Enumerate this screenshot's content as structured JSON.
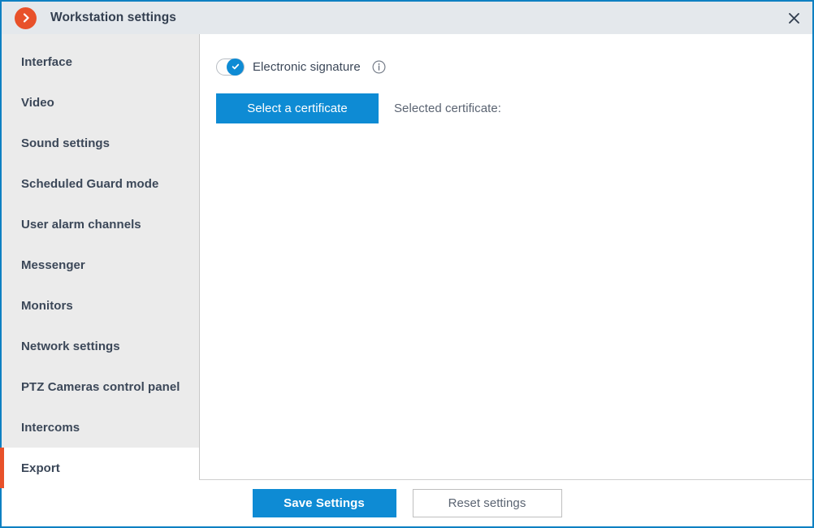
{
  "window": {
    "title": "Workstation settings",
    "app_icon": "chevron-right-circle-icon",
    "close_icon": "close-icon",
    "accent_orange": "#e8512a",
    "accent_blue": "#0e8bd4",
    "border_color": "#0e80c2",
    "titlebar_bg": "#e4e8ec",
    "sidebar_bg": "#ebebeb"
  },
  "sidebar": {
    "items": [
      {
        "label": "Interface",
        "selected": false
      },
      {
        "label": "Video",
        "selected": false
      },
      {
        "label": "Sound settings",
        "selected": false
      },
      {
        "label": "Scheduled Guard mode",
        "selected": false
      },
      {
        "label": "User alarm channels",
        "selected": false
      },
      {
        "label": "Messenger",
        "selected": false
      },
      {
        "label": "Monitors",
        "selected": false
      },
      {
        "label": "Network settings",
        "selected": false
      },
      {
        "label": "PTZ Cameras control panel",
        "selected": false
      },
      {
        "label": "Intercoms",
        "selected": false
      },
      {
        "label": "Export",
        "selected": true
      }
    ]
  },
  "content": {
    "electronic_signature": {
      "label": "Electronic signature",
      "toggle_state": "on",
      "toggle_icon": "check-icon",
      "info_icon": "info-icon"
    },
    "select_certificate_label": "Select a certificate",
    "selected_certificate_label": "Selected certificate:",
    "selected_certificate_value": ""
  },
  "footer": {
    "save_label": "Save Settings",
    "reset_label": "Reset settings"
  }
}
